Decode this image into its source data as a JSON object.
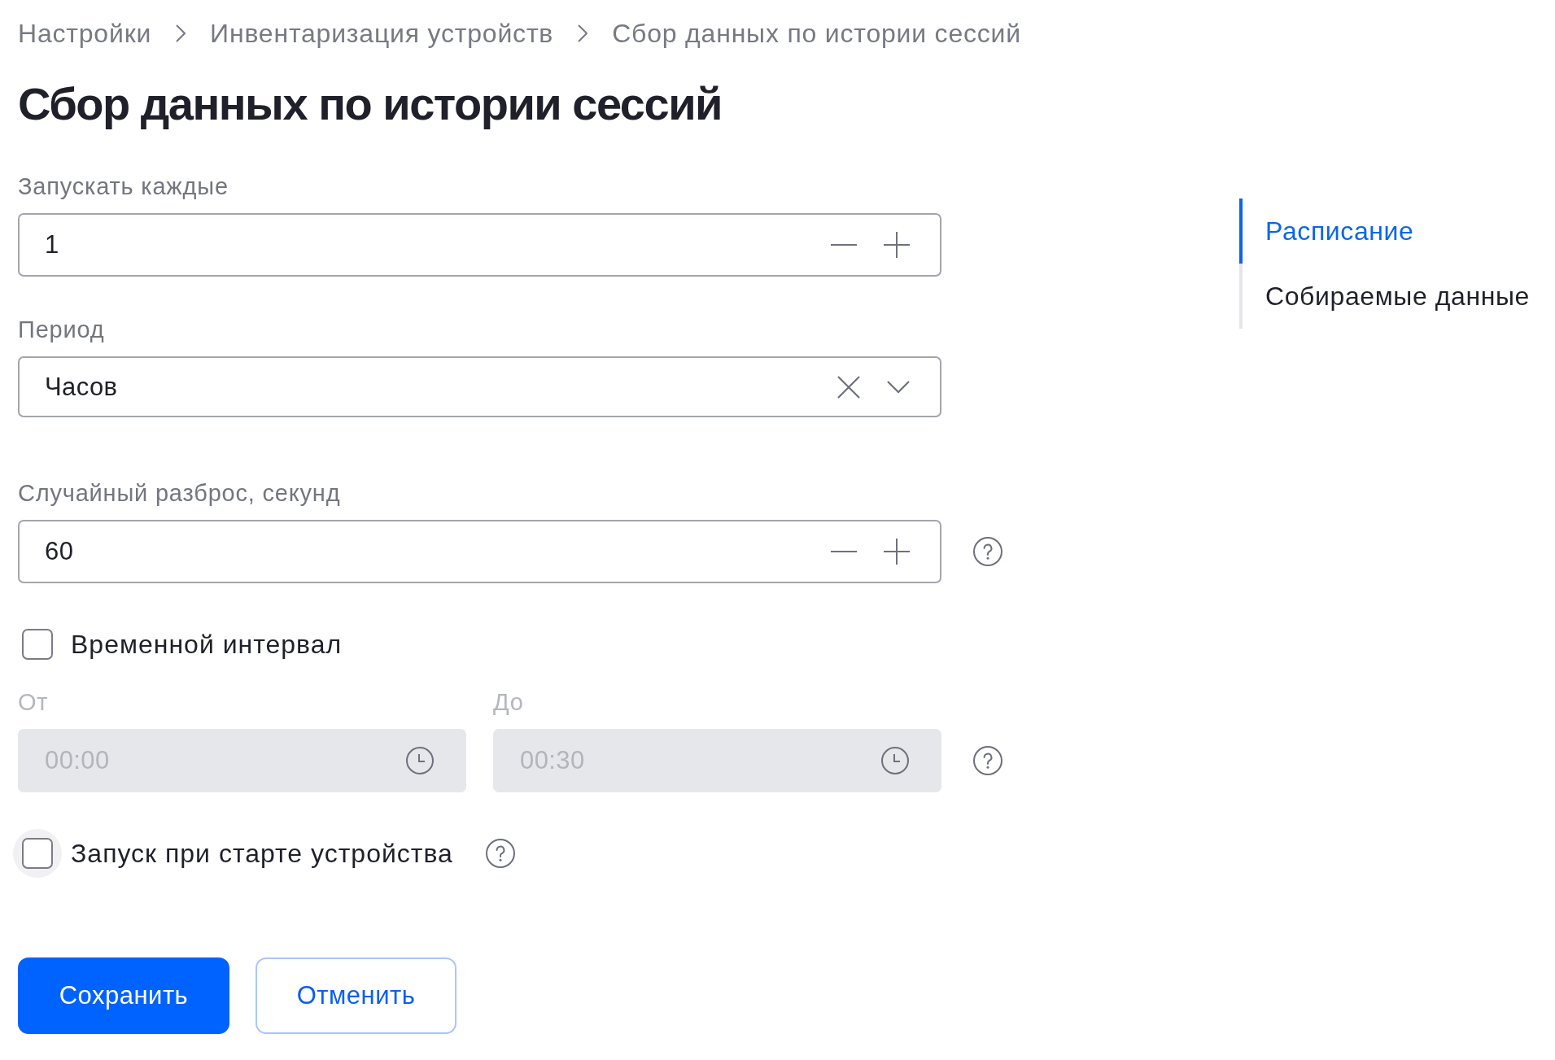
{
  "breadcrumb": [
    {
      "label": "Настройки"
    },
    {
      "label": "Инвентаризация устройств"
    },
    {
      "label": "Сбор данных по истории сессий"
    }
  ],
  "title": "Сбор данных по истории сессий",
  "fields": [
    {
      "kind": "number",
      "label": "Запускать каждые",
      "value": "1"
    },
    {
      "kind": "select",
      "label": "Период",
      "value": "Часов"
    },
    {
      "kind": "number",
      "label": "Случайный разброс, секунд",
      "value": "60",
      "help": true
    },
    {
      "kind": "checkbox",
      "label": "Временной интервал",
      "checked": false,
      "focused": false
    },
    {
      "kind": "time_range",
      "disabled": true,
      "help": true,
      "from": {
        "label": "От",
        "value": "00:00"
      },
      "to": {
        "label": "До",
        "value": "00:30"
      }
    },
    {
      "kind": "checkbox",
      "label": "Запуск при старте устройства",
      "checked": false,
      "focused": true,
      "help": true
    }
  ],
  "buttons": [
    {
      "kind": "primary",
      "label": "Сохранить"
    },
    {
      "kind": "outline",
      "label": "Отменить"
    }
  ],
  "side_nav": [
    {
      "label": "Расписание",
      "selected": true
    },
    {
      "label": "Собираемые данные",
      "selected": false
    }
  ]
}
